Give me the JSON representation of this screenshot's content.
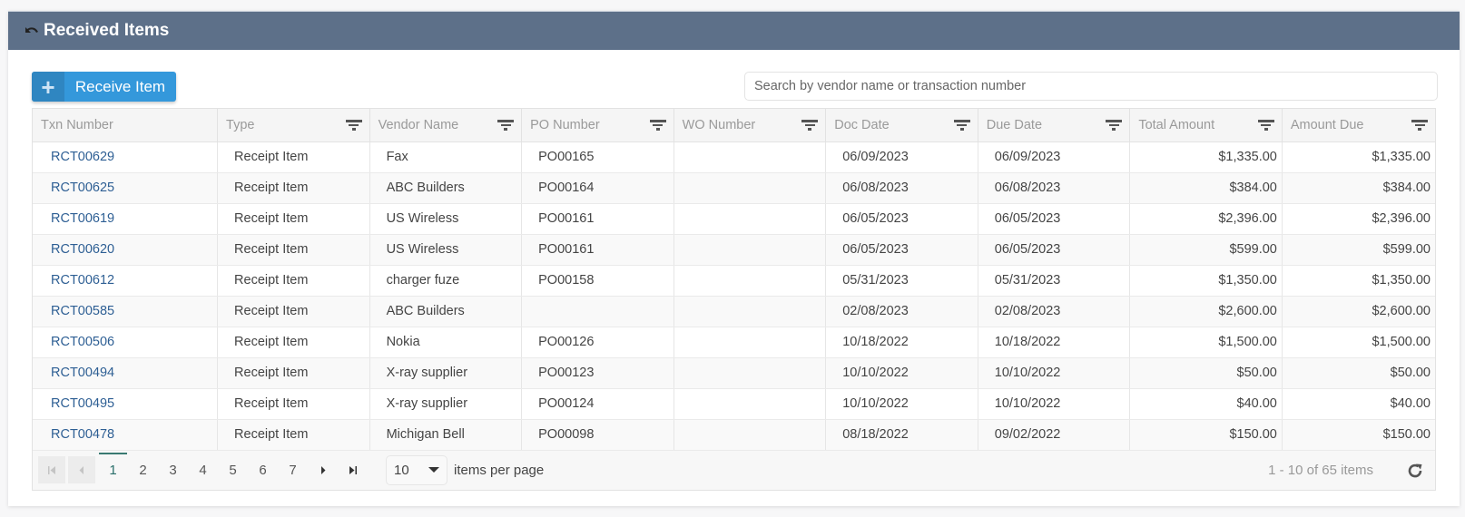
{
  "header": {
    "title": "Received Items",
    "back_icon": "undo-arrow-icon",
    "header_color": "#5d7089"
  },
  "toolbar": {
    "receive_button_label": "Receive Item",
    "receive_button_icon": "plus-icon",
    "button_color": "#3498db",
    "search_placeholder": "Search by vendor name or transaction number",
    "search_value": ""
  },
  "table": {
    "columns": [
      {
        "label": "Txn Number",
        "filter": false
      },
      {
        "label": "Type",
        "filter": true
      },
      {
        "label": "Vendor Name",
        "filter": true
      },
      {
        "label": "PO Number",
        "filter": true
      },
      {
        "label": "WO Number",
        "filter": true
      },
      {
        "label": "Doc Date",
        "filter": true
      },
      {
        "label": "Due Date",
        "filter": true
      },
      {
        "label": "Total Amount",
        "filter": true
      },
      {
        "label": "Amount Due",
        "filter": true
      }
    ],
    "rows": [
      {
        "txn": "RCT00629",
        "type": "Receipt Item",
        "vendor": "Fax",
        "po": "PO00165",
        "wo": "",
        "doc_date": "06/09/2023",
        "due_date": "06/09/2023",
        "total": "$1,335.00",
        "due": "$1,335.00"
      },
      {
        "txn": "RCT00625",
        "type": "Receipt Item",
        "vendor": "ABC Builders",
        "po": "PO00164",
        "wo": "",
        "doc_date": "06/08/2023",
        "due_date": "06/08/2023",
        "total": "$384.00",
        "due": "$384.00"
      },
      {
        "txn": "RCT00619",
        "type": "Receipt Item",
        "vendor": "US Wireless",
        "po": "PO00161",
        "wo": "",
        "doc_date": "06/05/2023",
        "due_date": "06/05/2023",
        "total": "$2,396.00",
        "due": "$2,396.00"
      },
      {
        "txn": "RCT00620",
        "type": "Receipt Item",
        "vendor": "US Wireless",
        "po": "PO00161",
        "wo": "",
        "doc_date": "06/05/2023",
        "due_date": "06/05/2023",
        "total": "$599.00",
        "due": "$599.00"
      },
      {
        "txn": "RCT00612",
        "type": "Receipt Item",
        "vendor": "charger fuze",
        "po": "PO00158",
        "wo": "",
        "doc_date": "05/31/2023",
        "due_date": "05/31/2023",
        "total": "$1,350.00",
        "due": "$1,350.00"
      },
      {
        "txn": "RCT00585",
        "type": "Receipt Item",
        "vendor": "ABC Builders",
        "po": "",
        "wo": "",
        "doc_date": "02/08/2023",
        "due_date": "02/08/2023",
        "total": "$2,600.00",
        "due": "$2,600.00"
      },
      {
        "txn": "RCT00506",
        "type": "Receipt Item",
        "vendor": "Nokia",
        "po": "PO00126",
        "wo": "",
        "doc_date": "10/18/2022",
        "due_date": "10/18/2022",
        "total": "$1,500.00",
        "due": "$1,500.00"
      },
      {
        "txn": "RCT00494",
        "type": "Receipt Item",
        "vendor": "X-ray supplier",
        "po": "PO00123",
        "wo": "",
        "doc_date": "10/10/2022",
        "due_date": "10/10/2022",
        "total": "$50.00",
        "due": "$50.00"
      },
      {
        "txn": "RCT00495",
        "type": "Receipt Item",
        "vendor": "X-ray supplier",
        "po": "PO00124",
        "wo": "",
        "doc_date": "10/10/2022",
        "due_date": "10/10/2022",
        "total": "$40.00",
        "due": "$40.00"
      },
      {
        "txn": "RCT00478",
        "type": "Receipt Item",
        "vendor": "Michigan Bell",
        "po": "PO00098",
        "wo": "",
        "doc_date": "08/18/2022",
        "due_date": "09/02/2022",
        "total": "$150.00",
        "due": "$150.00"
      }
    ]
  },
  "pager": {
    "pages": [
      "1",
      "2",
      "3",
      "4",
      "5",
      "6",
      "7"
    ],
    "current_page": "1",
    "page_size": "10",
    "per_page_label": "items per page",
    "info": "1 - 10 of 65 items",
    "first_icon": "first-page-icon",
    "prev_icon": "previous-page-icon",
    "next_icon": "next-page-icon",
    "last_icon": "last-page-icon",
    "refresh_icon": "refresh-icon"
  }
}
